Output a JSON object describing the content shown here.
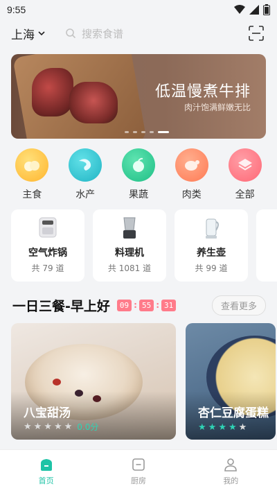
{
  "status_bar": {
    "time": "9:55"
  },
  "header": {
    "city": "上海",
    "search_placeholder": "搜索食谱"
  },
  "banner": {
    "title": "低温慢煮牛排",
    "subtitle": "肉汁饱满鲜嫩无比",
    "slide_count": 5,
    "active_slide": 4
  },
  "categories": [
    {
      "label": "主食",
      "color": "#ffc84a"
    },
    {
      "label": "水产",
      "color": "#37c9d4"
    },
    {
      "label": "果蔬",
      "color": "#35cf9a"
    },
    {
      "label": "肉类",
      "color": "#ff8b6a"
    },
    {
      "label": "全部",
      "color": "#ff7f88"
    }
  ],
  "devices": [
    {
      "name": "空气炸锅",
      "count": "共 79 道"
    },
    {
      "name": "料理机",
      "count": "共 1081 道"
    },
    {
      "name": "养生壶",
      "count": "共 99 道"
    }
  ],
  "section": {
    "title": "一日三餐-早上好",
    "timer": {
      "h": "09",
      "m": "55",
      "s": "31"
    },
    "more_label": "查看更多"
  },
  "recipes": [
    {
      "name": "八宝甜汤",
      "rating_text": "0.0分",
      "stars_filled": 0
    },
    {
      "name": "杏仁豆腐蛋糕",
      "rating_text": "",
      "stars_filled": 4
    }
  ],
  "tabs": [
    {
      "label": "首页",
      "active": true
    },
    {
      "label": "厨房",
      "active": false
    },
    {
      "label": "我的",
      "active": false
    }
  ],
  "colors": {
    "accent": "#1ec3a6",
    "timer": "#ff7b8a"
  }
}
